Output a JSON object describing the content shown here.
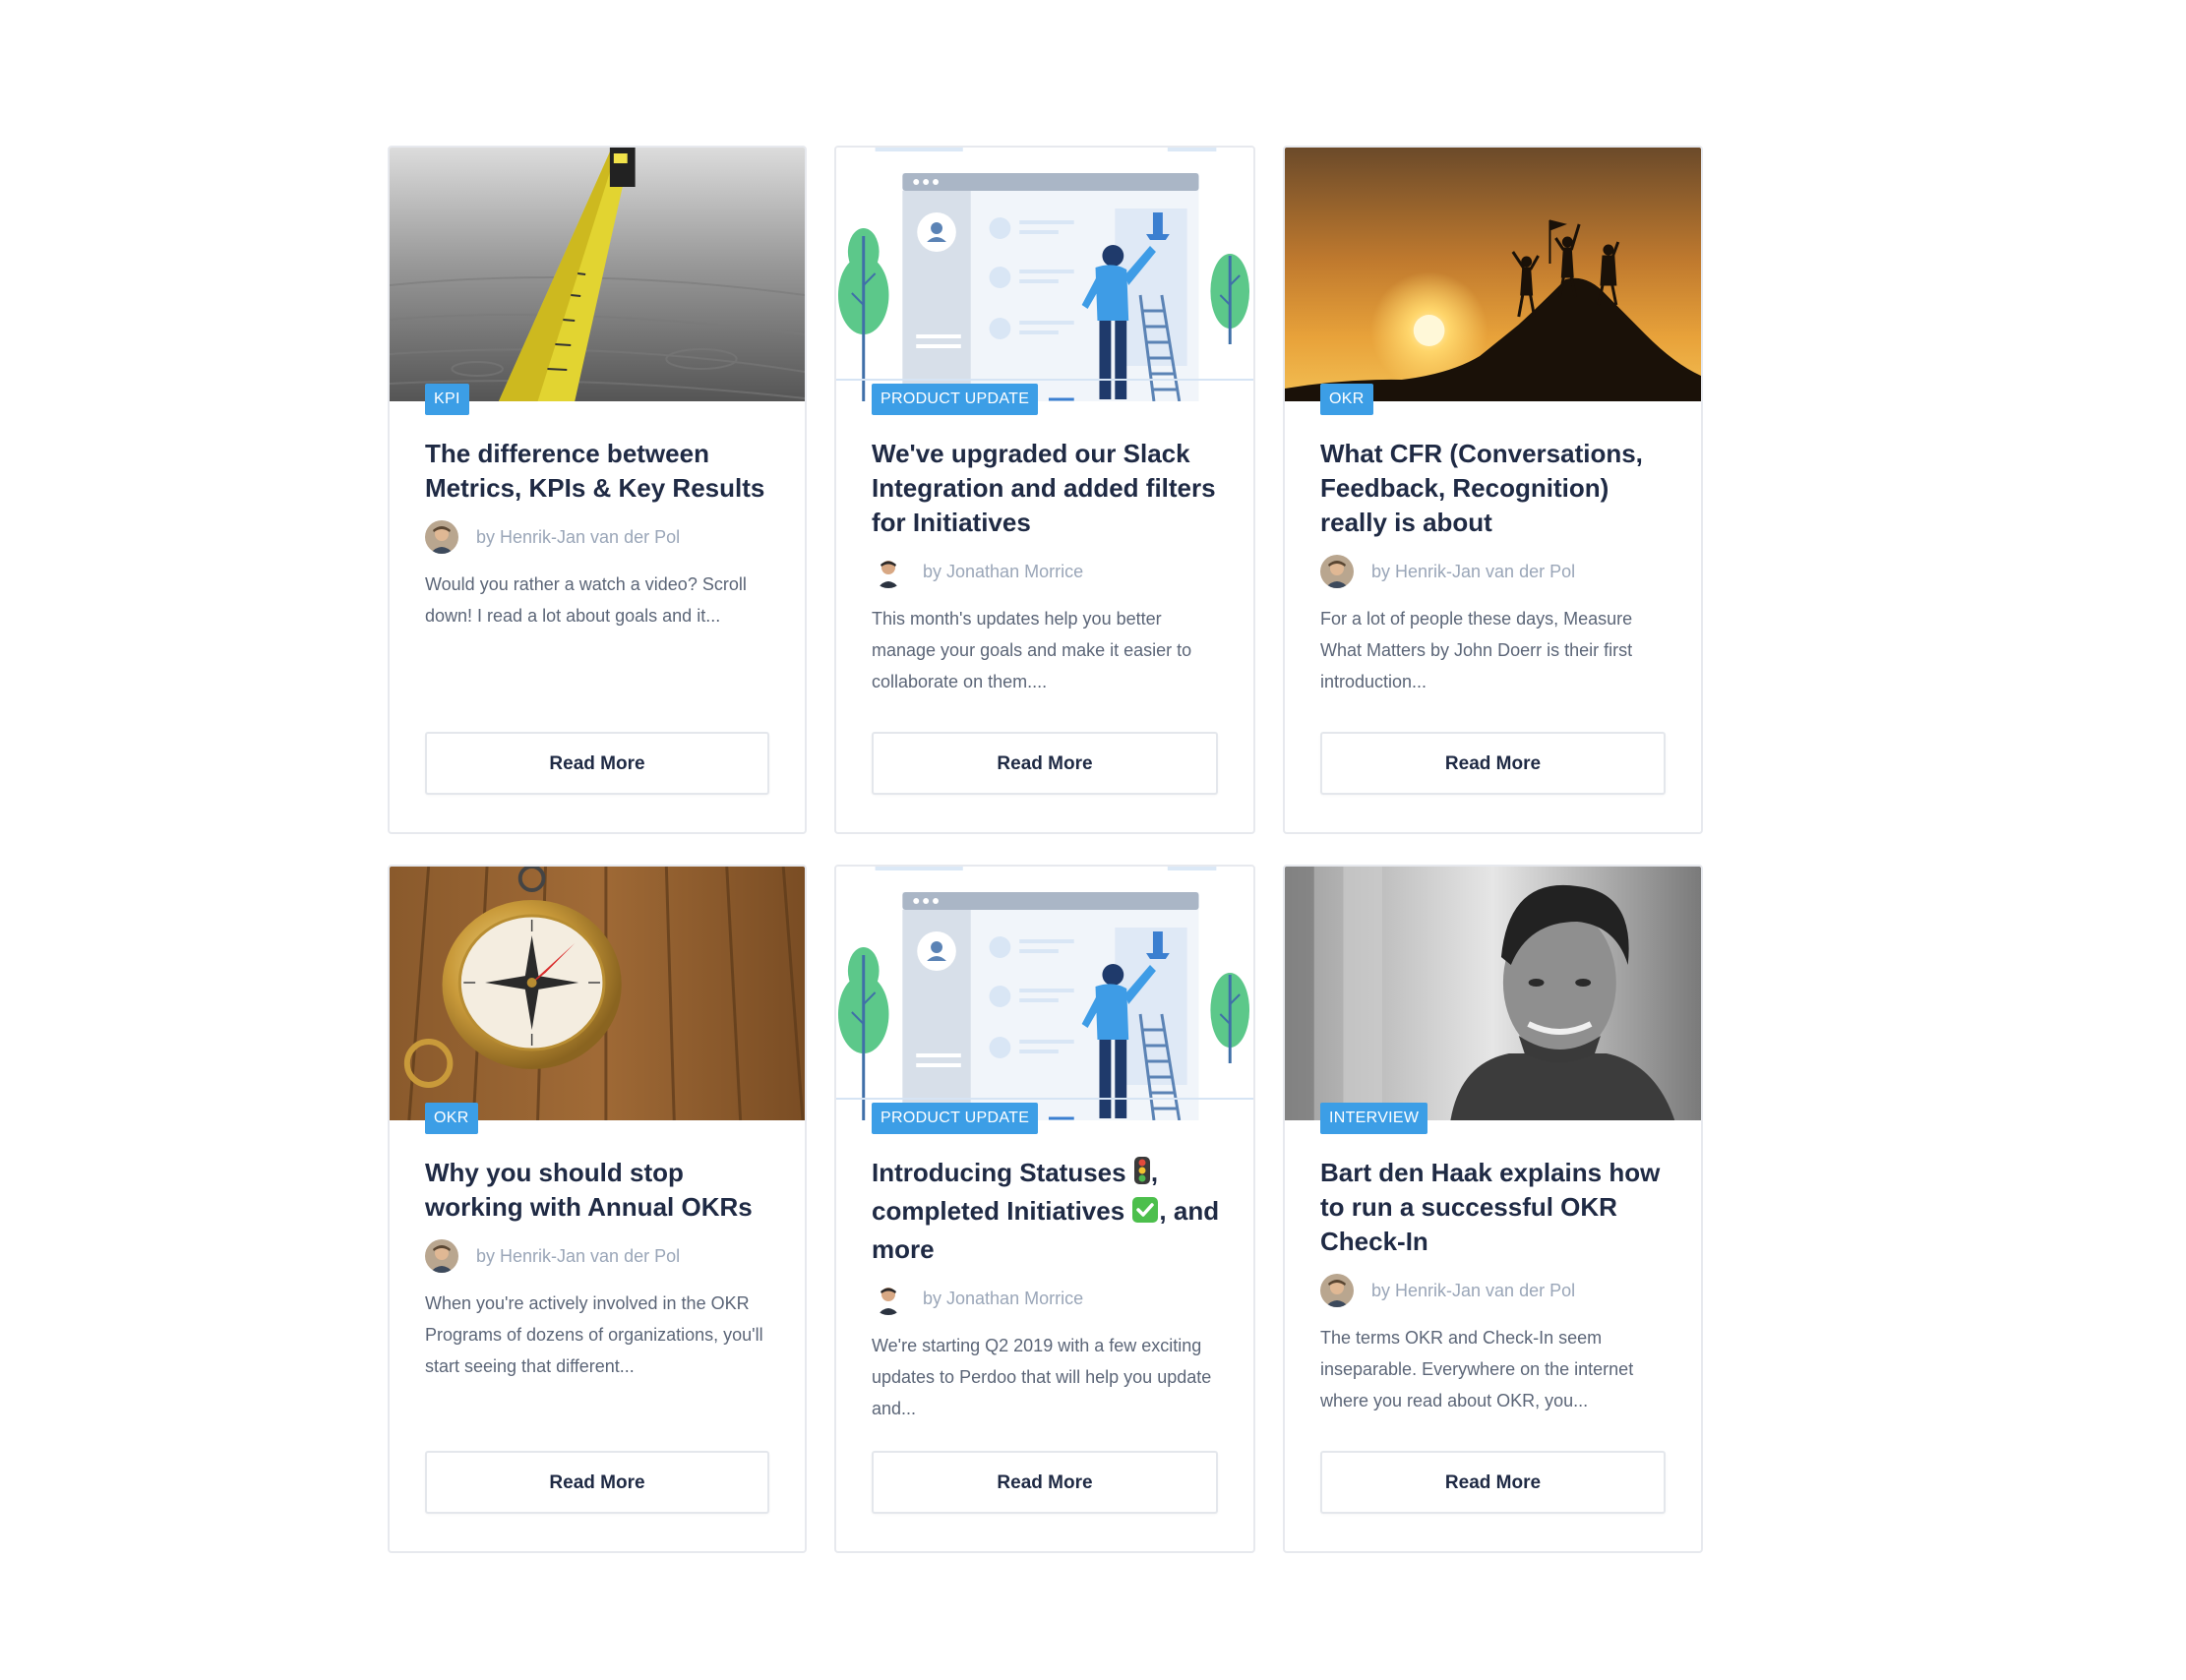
{
  "cards": [
    {
      "tag": "KPI",
      "title": "The difference between Metrics, KPIs & Key Results",
      "author": "by Henrik-Jan van der Pol",
      "excerpt": "Would you rather a watch a video? Scroll down! I read a lot about goals and it...",
      "button": "Read More",
      "image": "tape-measure-photo"
    },
    {
      "tag": "PRODUCT UPDATE",
      "title": "We've upgraded our Slack Integration and added filters for Initiatives",
      "author": "by Jonathan Morrice",
      "excerpt": "This month's updates help you better manage your goals and make it easier to collaborate on them....",
      "button": "Read More",
      "image": "product-update-illustration"
    },
    {
      "tag": "OKR",
      "title": "What CFR (Conversations, Feedback, Recognition) really is about",
      "author": "by Henrik-Jan van der Pol",
      "excerpt": "For a lot of people these days, Measure What Matters by John Doerr is their first introduction...",
      "button": "Read More",
      "image": "mountain-summit-photo"
    },
    {
      "tag": "OKR",
      "title": "Why you should stop working with Annual OKRs",
      "author": "by Henrik-Jan van der Pol",
      "excerpt": "When you're actively involved in the OKR Programs of dozens of organizations, you'll start seeing that different...",
      "button": "Read More",
      "image": "compass-photo"
    },
    {
      "tag": "PRODUCT UPDATE",
      "title_parts": [
        "Introducing Statuses",
        ", completed Initiatives",
        ", and more"
      ],
      "title_icons": [
        "traffic-light-icon",
        "check-mark-icon"
      ],
      "author": "by Jonathan Morrice",
      "excerpt": "We're starting Q2 2019 with a few exciting updates to Perdoo that will help you update and...",
      "button": "Read More",
      "image": "product-update-illustration"
    },
    {
      "tag": "INTERVIEW",
      "title": "Bart den Haak explains how to run a successful OKR Check-In",
      "author": "by Henrik-Jan van der Pol",
      "excerpt": "The terms OKR and Check-In seem inseparable. Everywhere on the internet where you read about OKR, you...",
      "button": "Read More",
      "image": "portrait-photo"
    }
  ],
  "colors": {
    "tag_bg": "#3c9ee6",
    "title": "#1f2a44",
    "author": "#9aa6b8",
    "excerpt": "#5b6577",
    "border": "#e7e9ee"
  }
}
